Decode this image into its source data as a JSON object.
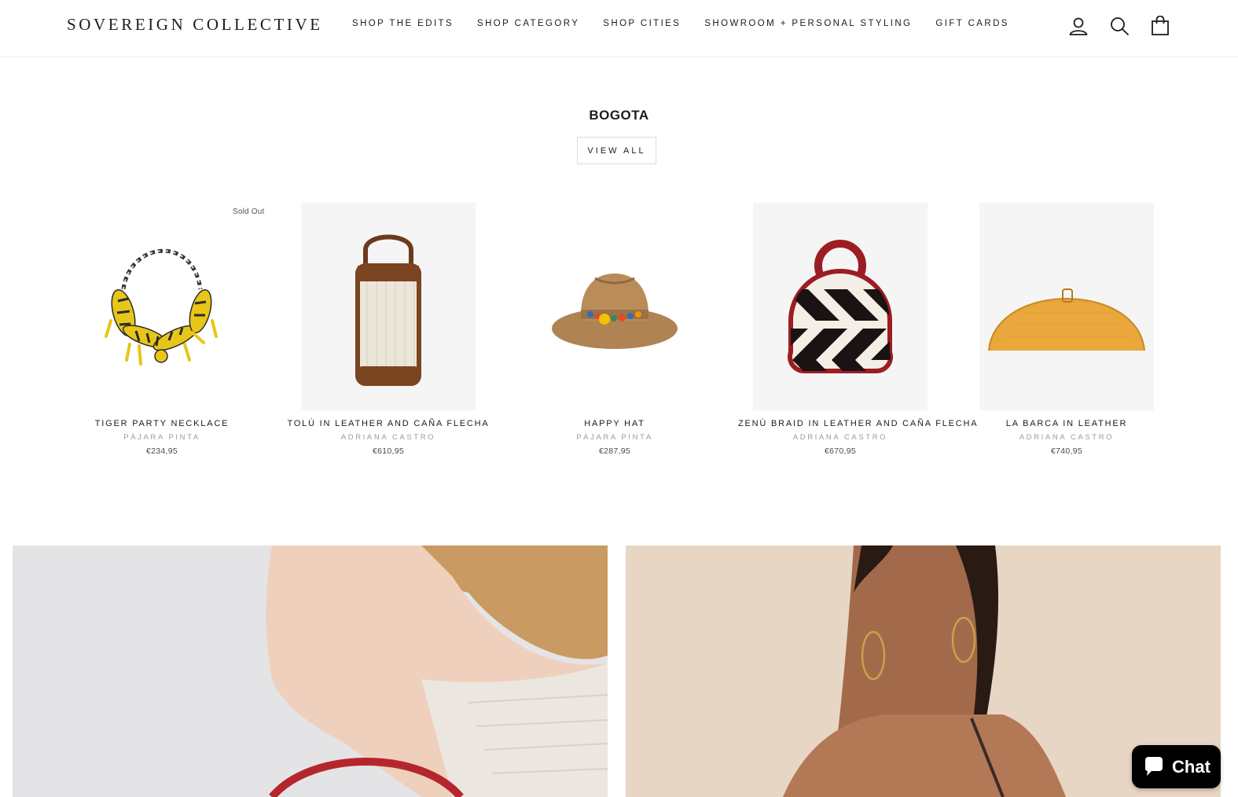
{
  "brand": {
    "logo_text": "SOVEREIGN COLLECTIVE"
  },
  "nav": {
    "items": [
      {
        "label": "SHOP THE EDITS"
      },
      {
        "label": "SHOP CATEGORY"
      },
      {
        "label": "SHOP CITIES"
      },
      {
        "label": "SHOWROOM + PERSONAL STYLING"
      },
      {
        "label": "GIFT CARDS"
      }
    ]
  },
  "header_icons": [
    "account-icon",
    "search-icon",
    "cart-icon"
  ],
  "section": {
    "title": "BOGOTA",
    "view_all_label": "VIEW ALL"
  },
  "products": [
    {
      "title": "TIGER PARTY NECKLACE",
      "vendor": "PÁJARA PINTA",
      "price": "€234,95",
      "badge": "Sold Out",
      "image_icon": "necklace-image"
    },
    {
      "title": "TOLÚ IN LEATHER AND CAÑA FLECHA",
      "vendor": "ADRIANA CASTRO",
      "price": "€610,95",
      "badge": "",
      "image_icon": "bucket-bag-image"
    },
    {
      "title": "HAPPY HAT",
      "vendor": "PÁJARA PINTA",
      "price": "€287,95",
      "badge": "",
      "image_icon": "hat-image"
    },
    {
      "title": "ZENÚ BRAID IN LEATHER AND CAÑA FLECHA",
      "vendor": "ADRIANA CASTRO",
      "price": "€670,95",
      "badge": "",
      "image_icon": "round-bag-image"
    },
    {
      "title": "LA BARCA IN LEATHER",
      "vendor": "ADRIANA CASTRO",
      "price": "€740,95",
      "badge": "",
      "image_icon": "half-moon-clutch-image"
    }
  ],
  "chat": {
    "label": "Chat"
  },
  "colors": {
    "text": "#1c1c1c",
    "muted": "#9a9a9a",
    "chat_bg": "#000000"
  }
}
